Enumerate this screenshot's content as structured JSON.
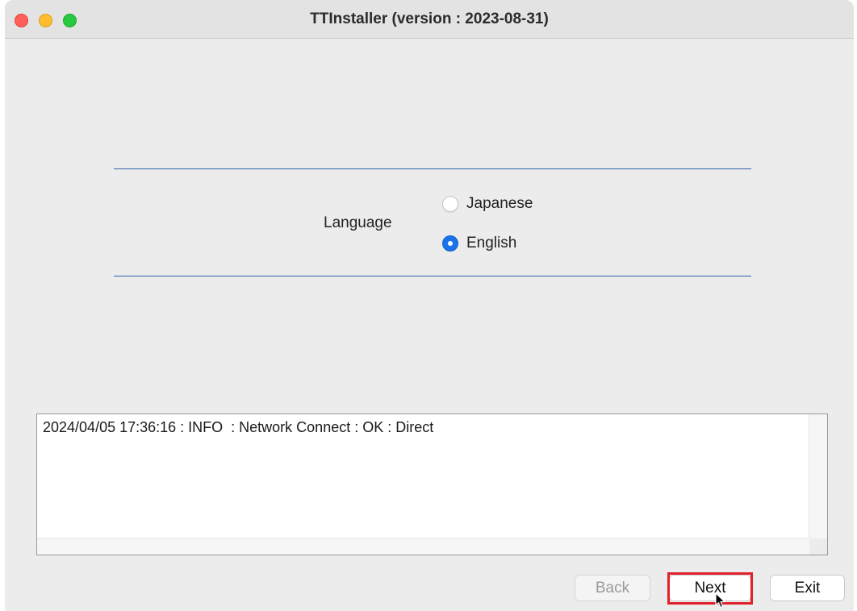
{
  "window": {
    "title": "TTInstaller  (version : 2023-08-31)"
  },
  "language": {
    "label": "Language",
    "options": [
      {
        "label": "Japanese",
        "selected": false
      },
      {
        "label": "English",
        "selected": true
      }
    ]
  },
  "log": {
    "lines": [
      "2024/04/05 17:36:16 : INFO  : Network Connect : OK : Direct"
    ]
  },
  "buttons": {
    "back_label": "Back",
    "back_enabled": false,
    "next_label": "Next",
    "exit_label": "Exit"
  },
  "colors": {
    "accent": "#1a73e8",
    "rule": "#2e5fa8",
    "highlight": "#e0202a"
  },
  "icons": {
    "close": "close-window-icon",
    "minimize": "minimize-window-icon",
    "maximize": "maximize-window-icon",
    "cursor": "mouse-pointer-icon"
  }
}
